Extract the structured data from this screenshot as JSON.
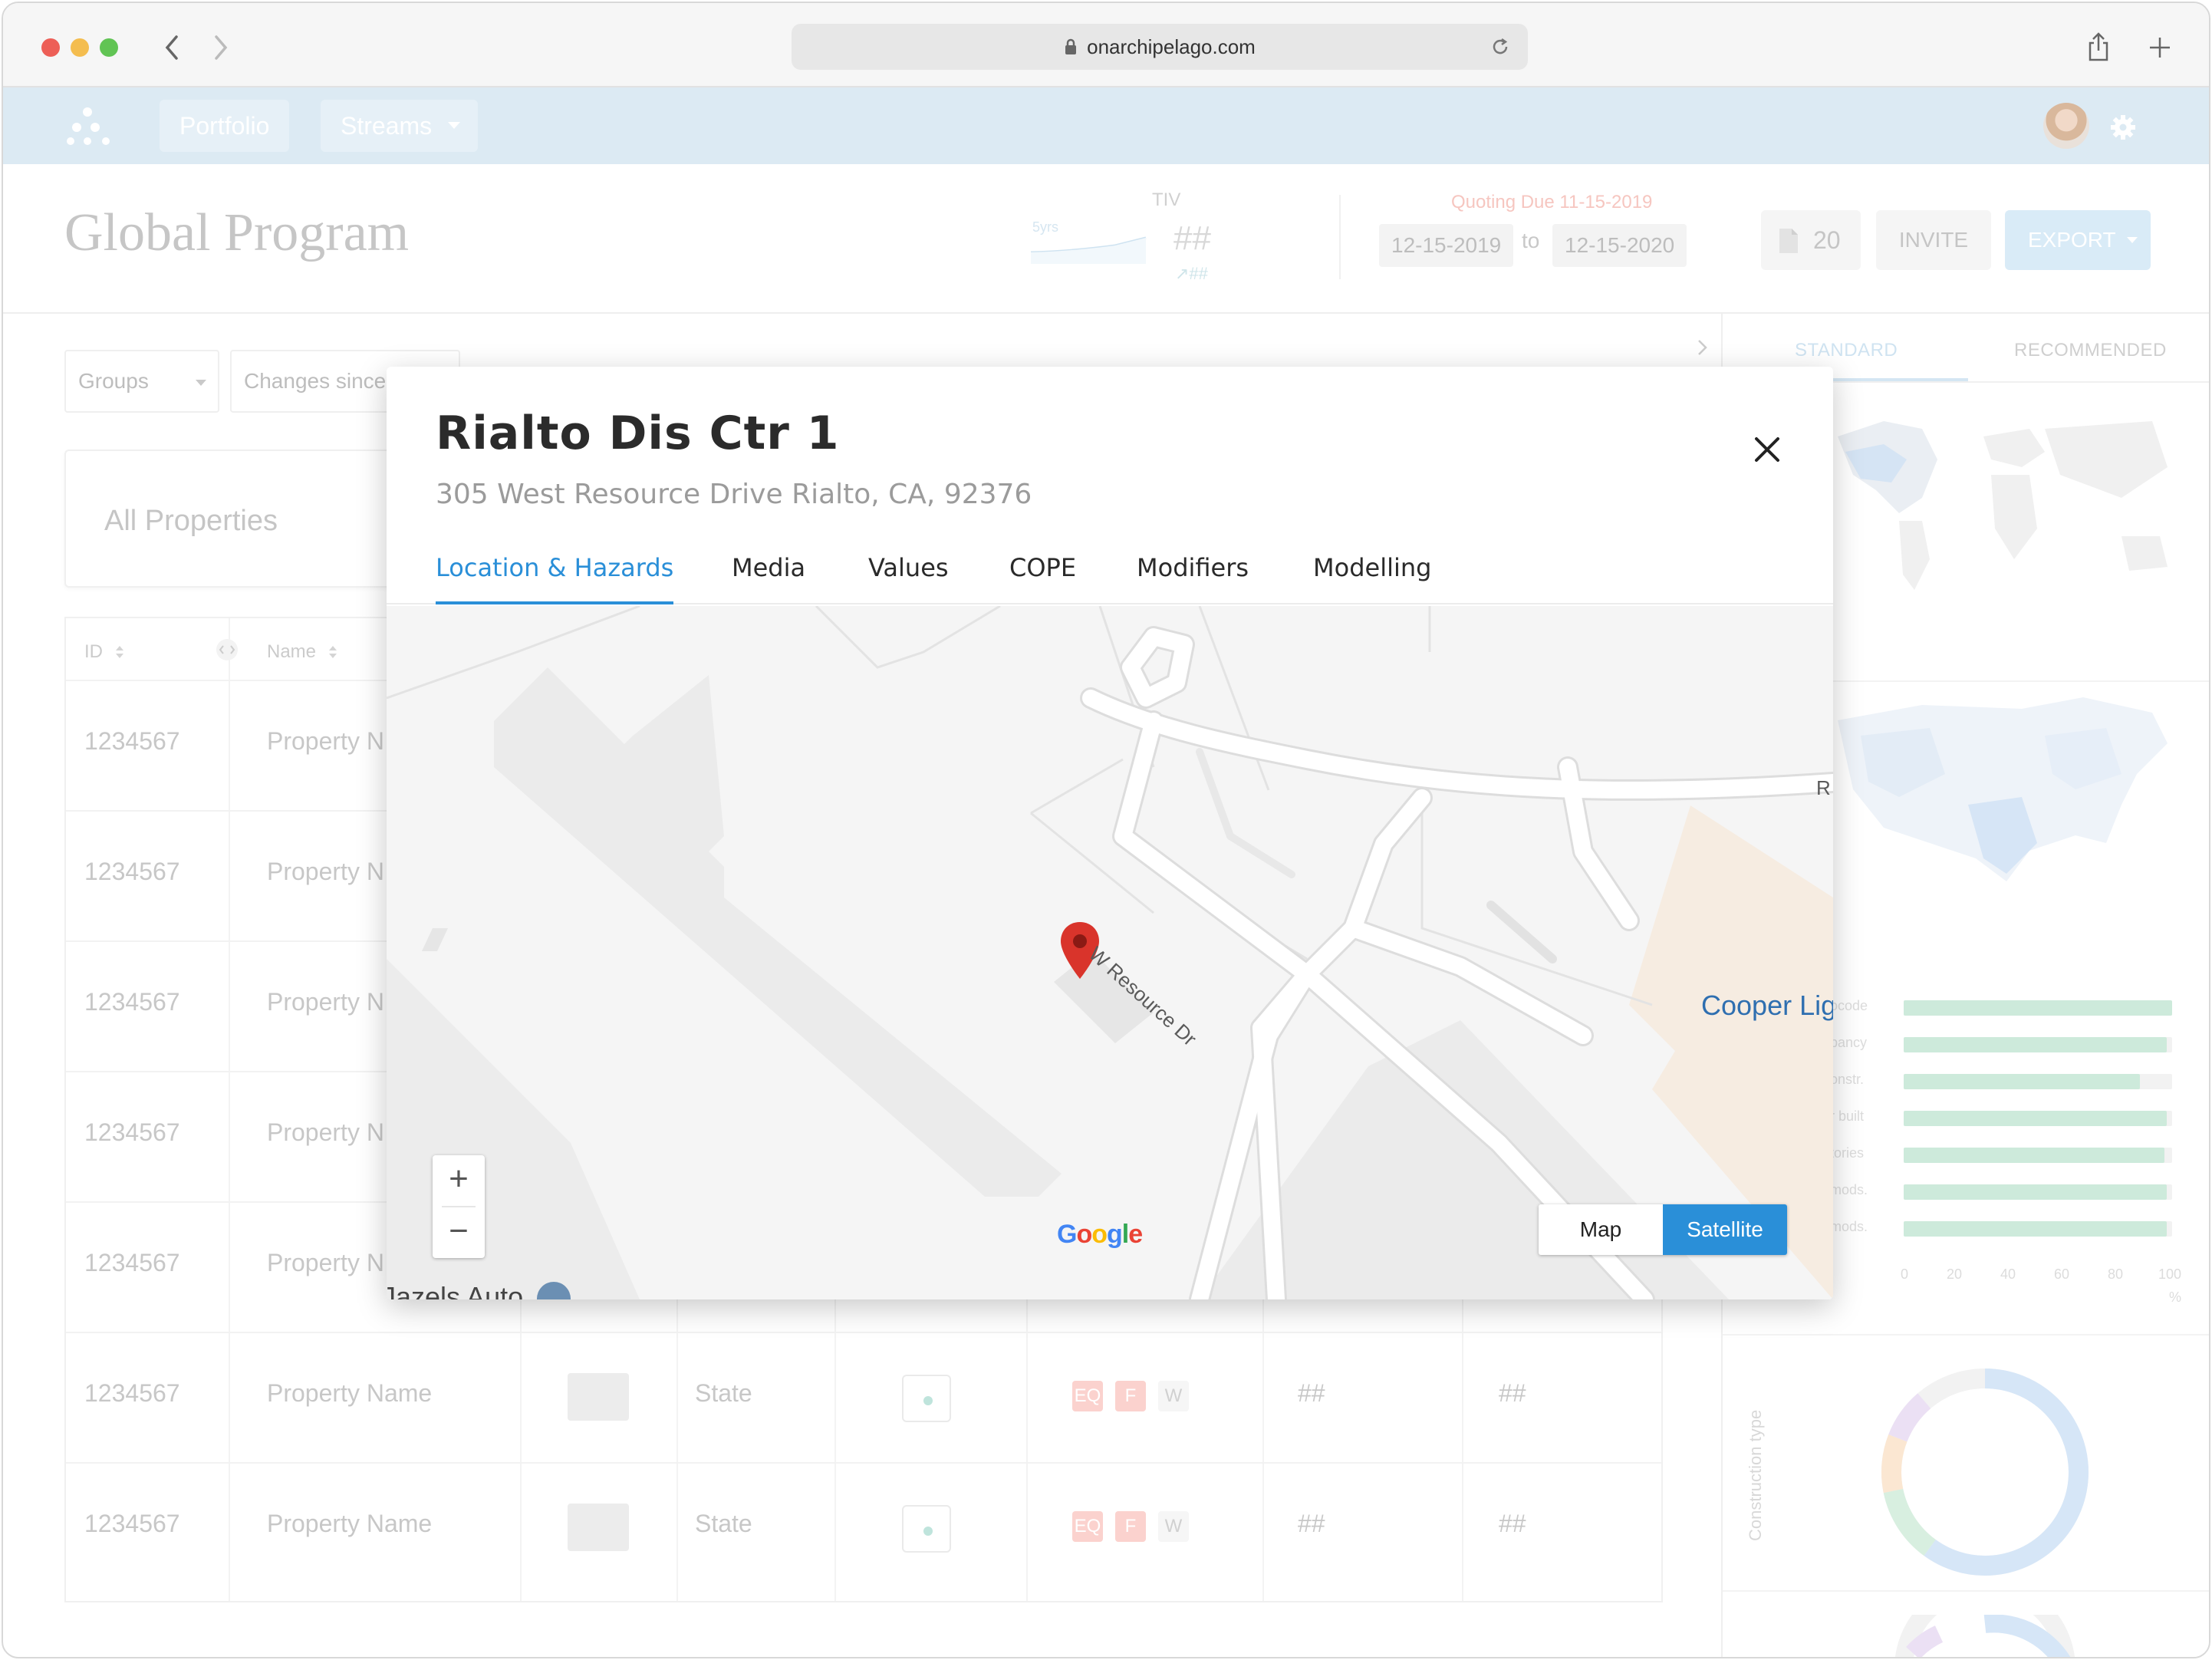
{
  "browser": {
    "url": "onarchipelago.com"
  },
  "nav": {
    "portfolio": "Portfolio",
    "streams": "Streams"
  },
  "header": {
    "title": "Global Program",
    "tiv_label": "TIV",
    "tiv_value": "##",
    "tiv_change": "↗##",
    "tiv_trend_label": "5yrs",
    "quoting_due": "Quoting Due 11-15-2019",
    "date_from": "12-15-2019",
    "date_to_word": "to",
    "date_to": "12-15-2020",
    "doc_count": "20",
    "invite": "INVITE",
    "export": "EXPORT"
  },
  "filters": {
    "groups": "Groups",
    "changes_since": "Changes since"
  },
  "all_properties": "All Properties",
  "table": {
    "headers": {
      "id": "ID",
      "name": "Name"
    },
    "rows": [
      {
        "id": "1234567",
        "name": "Property N"
      },
      {
        "id": "1234567",
        "name": "Property N"
      },
      {
        "id": "1234567",
        "name": "Property N"
      },
      {
        "id": "1234567",
        "name": "Property N"
      },
      {
        "id": "1234567",
        "name": "Property N"
      },
      {
        "id": "1234567",
        "name": "Property Name",
        "state": "State",
        "hazards": [
          "EQ",
          "F",
          "W"
        ],
        "v1": "##",
        "v2": "##"
      },
      {
        "id": "1234567",
        "name": "Property Name",
        "state": "State",
        "hazards": [
          "EQ",
          "F",
          "W"
        ],
        "v1": "##",
        "v2": "##"
      }
    ]
  },
  "right_panel": {
    "tab_standard": "STANDARD",
    "tab_recommended": "RECOMMENDED",
    "bar_labels": [
      "ocode",
      "pancy",
      "onstr.",
      "r built",
      "tories",
      "mods.",
      "mods."
    ],
    "bar_values": [
      100,
      98,
      88,
      98,
      97,
      98,
      98
    ],
    "bar_ticks": [
      "0",
      "20",
      "40",
      "60",
      "80",
      "100"
    ],
    "bar_unit": "%",
    "donut_label": "Construction type"
  },
  "modal": {
    "title": "Rialto Dis Ctr 1",
    "address": "305 West Resource Drive Rialto, CA, 92376",
    "tabs": [
      "Location & Hazards",
      "Media",
      "Values",
      "COPE",
      "Modifiers",
      "Modelling"
    ],
    "active_tab": "Location & Hazards",
    "map": {
      "road_label": "W Resource Dr",
      "road_label_edge": "R",
      "poi_label": "Cooper Lig",
      "poi_label_bottom": "Jazels Auto",
      "zoom_in": "+",
      "zoom_out": "−",
      "map_type_map": "Map",
      "map_type_satellite": "Satellite",
      "selected_map_type": "Satellite",
      "attribution": "Google",
      "marker_color": "#d9342b"
    }
  },
  "colors": {
    "accent": "#2a8fd8",
    "nav_bg": "#dceaf3",
    "satellite_btn": "#2a8fd8",
    "hazard_eq": "#f8b9b3",
    "marker": "#d9342b"
  },
  "icons": [
    "back-arrow-icon",
    "forward-arrow-icon",
    "lock-icon",
    "reload-icon",
    "share-icon",
    "new-tab-icon",
    "logo-icon",
    "gear-icon",
    "document-icon",
    "close-icon",
    "map-marker-icon",
    "sort-icon"
  ]
}
